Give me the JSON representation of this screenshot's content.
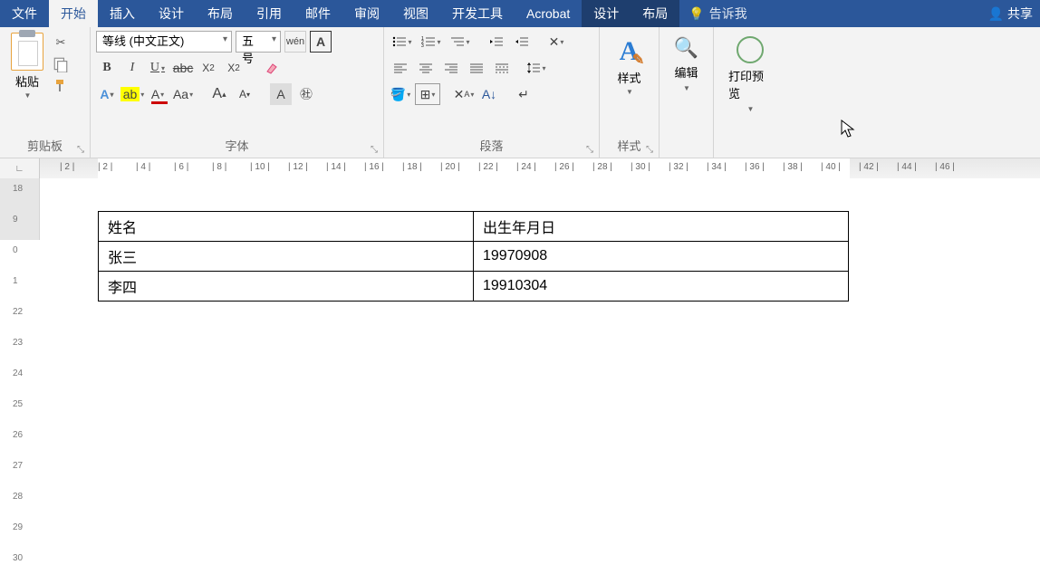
{
  "menu": {
    "file": "文件",
    "home": "开始",
    "insert": "插入",
    "design1": "设计",
    "layout1": "布局",
    "references": "引用",
    "mailings": "邮件",
    "review": "审阅",
    "view": "视图",
    "devtools": "开发工具",
    "acrobat": "Acrobat",
    "design2": "设计",
    "layout2": "布局",
    "tellme": "告诉我",
    "share": "共享"
  },
  "ribbon": {
    "clipboard": {
      "label": "剪贴板",
      "paste": "粘贴"
    },
    "font": {
      "label": "字体",
      "name": "等线 (中文正文)",
      "size": "五号",
      "wen": "wén",
      "boxA": "A"
    },
    "paragraph": {
      "label": "段落"
    },
    "styles": {
      "label": "样式",
      "button": "样式"
    },
    "edit": {
      "label": "编辑"
    },
    "preview": {
      "label": "打印预览"
    }
  },
  "table": {
    "header": {
      "c1": "姓名",
      "c2": "出生年月日"
    },
    "rows": [
      {
        "c1": "张三",
        "c2": "19970908"
      },
      {
        "c1": "李四",
        "c2": "19910304"
      }
    ]
  },
  "ruler_h": [
    "2",
    "2",
    "4",
    "6",
    "8",
    "10",
    "12",
    "14",
    "16",
    "18",
    "20",
    "22",
    "24",
    "26",
    "28",
    "30",
    "32",
    "34",
    "36",
    "38",
    "40",
    "42",
    "44",
    "46"
  ],
  "ruler_v": [
    "18",
    "9",
    "0",
    "1",
    "22",
    "23",
    "24",
    "25",
    "26",
    "27",
    "28",
    "29",
    "30"
  ]
}
